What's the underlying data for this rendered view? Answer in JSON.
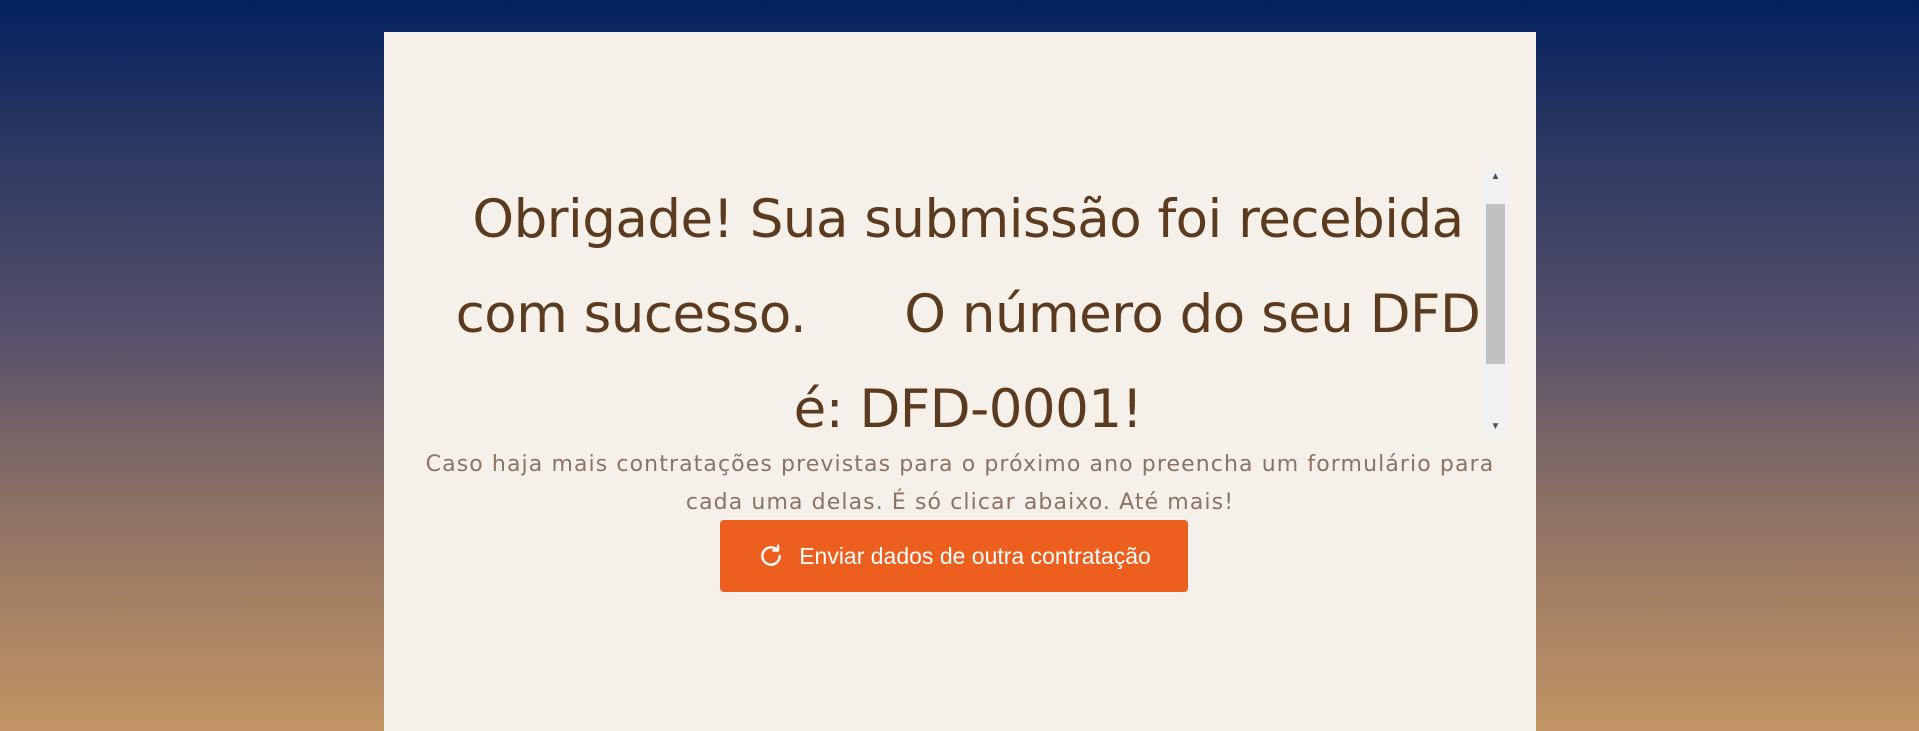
{
  "confirmation": {
    "title": "Obrigade! Sua submissão foi recebida com sucesso.      O número do seu DFD é: DFD-0001!",
    "subtitle": "Caso haja mais contratações previstas para o próximo ano preencha um formulário para cada uma delas. É só clicar abaixo. Até mais!"
  },
  "actions": {
    "resubmit_label": "Enviar dados de outra contratação",
    "resubmit_icon": "refresh-icon"
  },
  "colors": {
    "background_top": "#03215f",
    "background_bottom": "#c39565",
    "card": "#f6f0ea",
    "title_text": "#5b3a1e",
    "subtitle_text": "#8a7464",
    "button": "#ed5f1f",
    "button_text": "#ffffff"
  }
}
